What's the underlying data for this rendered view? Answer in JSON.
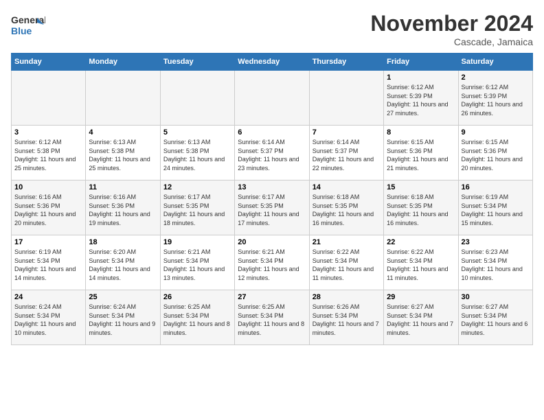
{
  "header": {
    "logo_line1": "General",
    "logo_line2": "Blue",
    "month": "November 2024",
    "location": "Cascade, Jamaica"
  },
  "days_of_week": [
    "Sunday",
    "Monday",
    "Tuesday",
    "Wednesday",
    "Thursday",
    "Friday",
    "Saturday"
  ],
  "weeks": [
    [
      {
        "day": "",
        "info": ""
      },
      {
        "day": "",
        "info": ""
      },
      {
        "day": "",
        "info": ""
      },
      {
        "day": "",
        "info": ""
      },
      {
        "day": "",
        "info": ""
      },
      {
        "day": "1",
        "info": "Sunrise: 6:12 AM\nSunset: 5:39 PM\nDaylight: 11 hours and 27 minutes."
      },
      {
        "day": "2",
        "info": "Sunrise: 6:12 AM\nSunset: 5:39 PM\nDaylight: 11 hours and 26 minutes."
      }
    ],
    [
      {
        "day": "3",
        "info": "Sunrise: 6:12 AM\nSunset: 5:38 PM\nDaylight: 11 hours and 25 minutes."
      },
      {
        "day": "4",
        "info": "Sunrise: 6:13 AM\nSunset: 5:38 PM\nDaylight: 11 hours and 25 minutes."
      },
      {
        "day": "5",
        "info": "Sunrise: 6:13 AM\nSunset: 5:38 PM\nDaylight: 11 hours and 24 minutes."
      },
      {
        "day": "6",
        "info": "Sunrise: 6:14 AM\nSunset: 5:37 PM\nDaylight: 11 hours and 23 minutes."
      },
      {
        "day": "7",
        "info": "Sunrise: 6:14 AM\nSunset: 5:37 PM\nDaylight: 11 hours and 22 minutes."
      },
      {
        "day": "8",
        "info": "Sunrise: 6:15 AM\nSunset: 5:36 PM\nDaylight: 11 hours and 21 minutes."
      },
      {
        "day": "9",
        "info": "Sunrise: 6:15 AM\nSunset: 5:36 PM\nDaylight: 11 hours and 20 minutes."
      }
    ],
    [
      {
        "day": "10",
        "info": "Sunrise: 6:16 AM\nSunset: 5:36 PM\nDaylight: 11 hours and 20 minutes."
      },
      {
        "day": "11",
        "info": "Sunrise: 6:16 AM\nSunset: 5:36 PM\nDaylight: 11 hours and 19 minutes."
      },
      {
        "day": "12",
        "info": "Sunrise: 6:17 AM\nSunset: 5:35 PM\nDaylight: 11 hours and 18 minutes."
      },
      {
        "day": "13",
        "info": "Sunrise: 6:17 AM\nSunset: 5:35 PM\nDaylight: 11 hours and 17 minutes."
      },
      {
        "day": "14",
        "info": "Sunrise: 6:18 AM\nSunset: 5:35 PM\nDaylight: 11 hours and 16 minutes."
      },
      {
        "day": "15",
        "info": "Sunrise: 6:18 AM\nSunset: 5:35 PM\nDaylight: 11 hours and 16 minutes."
      },
      {
        "day": "16",
        "info": "Sunrise: 6:19 AM\nSunset: 5:34 PM\nDaylight: 11 hours and 15 minutes."
      }
    ],
    [
      {
        "day": "17",
        "info": "Sunrise: 6:19 AM\nSunset: 5:34 PM\nDaylight: 11 hours and 14 minutes."
      },
      {
        "day": "18",
        "info": "Sunrise: 6:20 AM\nSunset: 5:34 PM\nDaylight: 11 hours and 14 minutes."
      },
      {
        "day": "19",
        "info": "Sunrise: 6:21 AM\nSunset: 5:34 PM\nDaylight: 11 hours and 13 minutes."
      },
      {
        "day": "20",
        "info": "Sunrise: 6:21 AM\nSunset: 5:34 PM\nDaylight: 11 hours and 12 minutes."
      },
      {
        "day": "21",
        "info": "Sunrise: 6:22 AM\nSunset: 5:34 PM\nDaylight: 11 hours and 11 minutes."
      },
      {
        "day": "22",
        "info": "Sunrise: 6:22 AM\nSunset: 5:34 PM\nDaylight: 11 hours and 11 minutes."
      },
      {
        "day": "23",
        "info": "Sunrise: 6:23 AM\nSunset: 5:34 PM\nDaylight: 11 hours and 10 minutes."
      }
    ],
    [
      {
        "day": "24",
        "info": "Sunrise: 6:24 AM\nSunset: 5:34 PM\nDaylight: 11 hours and 10 minutes."
      },
      {
        "day": "25",
        "info": "Sunrise: 6:24 AM\nSunset: 5:34 PM\nDaylight: 11 hours and 9 minutes."
      },
      {
        "day": "26",
        "info": "Sunrise: 6:25 AM\nSunset: 5:34 PM\nDaylight: 11 hours and 8 minutes."
      },
      {
        "day": "27",
        "info": "Sunrise: 6:25 AM\nSunset: 5:34 PM\nDaylight: 11 hours and 8 minutes."
      },
      {
        "day": "28",
        "info": "Sunrise: 6:26 AM\nSunset: 5:34 PM\nDaylight: 11 hours and 7 minutes."
      },
      {
        "day": "29",
        "info": "Sunrise: 6:27 AM\nSunset: 5:34 PM\nDaylight: 11 hours and 7 minutes."
      },
      {
        "day": "30",
        "info": "Sunrise: 6:27 AM\nSunset: 5:34 PM\nDaylight: 11 hours and 6 minutes."
      }
    ]
  ]
}
